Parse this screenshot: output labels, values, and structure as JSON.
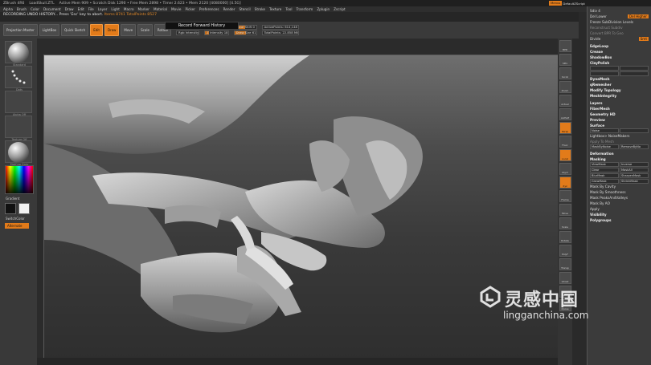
{
  "titlebar": {
    "app": "ZBrush 4R6",
    "doc": "LoadSkull.ZTL",
    "stats": "Active Mem 909 • Scratch Disk 1290 • Free Mem 2898 • Timer 2.623 • Mem 2120 [4080000] [4.5G]",
    "menus_btn": "Menus",
    "script": "DefaultZScript"
  },
  "menubar": [
    "Alpha",
    "Brush",
    "Color",
    "Document",
    "Draw",
    "Edit",
    "File",
    "Layer",
    "Light",
    "Macro",
    "Marker",
    "Material",
    "Movie",
    "Picker",
    "Preferences",
    "Render",
    "Stencil",
    "Stroke",
    "Texture",
    "Tool",
    "Transform",
    "Zplugin",
    "Zscript"
  ],
  "status": {
    "message": "RECORDING UNDO HISTORY... Press 'Esc' key to abort.",
    "counts": "Items 8741  TotalPoints 8527"
  },
  "shelf": {
    "projection": "Projection Master",
    "lightbox": "LightBox",
    "quicksketch": "Quick Sketch",
    "edit": "Edit",
    "draw": "Draw",
    "move": "Move",
    "scale": "Scale",
    "rotate": "Rotate",
    "mrgb": "Mrgb",
    "rgb": "Rgb",
    "m": "M",
    "zadd": "Zadd",
    "zsub": "Zsub",
    "zcut": "Zcut",
    "rgb_intensity": "Rgb Intensity",
    "z_intensity": "Z Intensity 18",
    "focal_shift": "Focal Shift 0",
    "draw_size": "Draw Size 61",
    "active_points": "ActivePoints: 614,148",
    "total_points": "TotalPoints: 22.858 Mil"
  },
  "record_tip": "Record Forward History",
  "left": {
    "brush_label": "Standard",
    "stroke_label": "Dots",
    "alpha_label": "Alpha Off",
    "texture_label": "Texture Off",
    "material_label": "MatCap Gray",
    "gradient": "Gradient",
    "switch_color": "SwitchColor",
    "alternate": "Alternate"
  },
  "right_tools": [
    "BPR",
    "SPix",
    "Scroll",
    "Zoom",
    "Actual",
    "AAHalf",
    "Persp",
    "Floor",
    "Local",
    "LSym",
    "Xyz",
    "Frame",
    "Move",
    "Scale",
    "Rotate",
    "PolyF",
    "Transp",
    "Ghost",
    "Solo",
    "Xpose"
  ],
  "right_panel": {
    "top": [
      {
        "label": "Sdiv 4",
        "tag": ""
      },
      {
        "label": "Del Lower",
        "tag": "Del Higher"
      },
      {
        "label": "Freeze SubDivision Levels",
        "tag": ""
      },
      {
        "label": "Reconstruct Subdiv",
        "tag": ""
      },
      {
        "label": "Convert BPR To Geo",
        "tag": ""
      },
      {
        "label": "Divide",
        "tag": "Smt"
      }
    ],
    "sections": [
      "EdgeLoop",
      "Crease",
      "ShadowBox",
      "ClayPolish",
      "DynaMesh",
      "qRemesher",
      "Modify Topology",
      "MeshIntegrity",
      "Layers",
      "FiberMesh",
      "Geometry HD",
      "Preview",
      "Surface",
      "Deformation",
      "Masking"
    ],
    "surface": {
      "noise": "Noise",
      "lightbox_noise": "Lightbox> NoiseMakers",
      "apply": "Apply To Mesh",
      "mask_uv": "MaskByNoise",
      "remove": "RemoveByNo"
    },
    "masking": [
      [
        "ViewMask",
        "Inverse"
      ],
      [
        "Clear",
        "MaskAll"
      ],
      [
        "BlurMask",
        "SharpenMask"
      ],
      [
        "GrowMask",
        "ShrinkMask"
      ]
    ],
    "bottom": [
      "Mask By Cavity",
      "Mask By Smoothness",
      "Mask PeaksAndValleys",
      "Mask By AO",
      "Apply",
      "Visibility",
      "Polygroups"
    ]
  },
  "watermark": {
    "name": "灵感中国",
    "url": "lingganchina.com"
  },
  "colors": {
    "accent": "#e27b1a",
    "panel": "#3b3b3b",
    "bg": "#2a2a2a"
  }
}
